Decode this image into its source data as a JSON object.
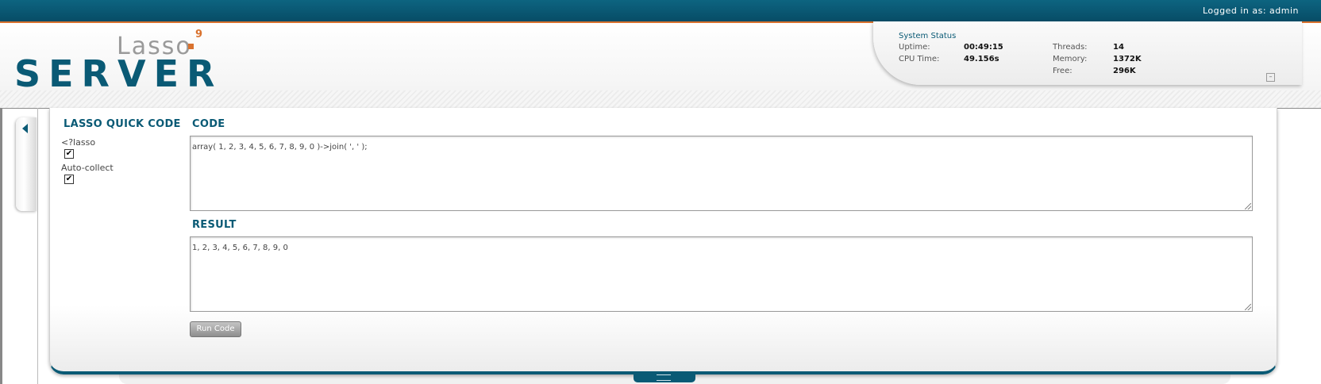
{
  "topbar": {
    "logged_in": "Logged in as: admin"
  },
  "logo": {
    "lasso": "Lasso",
    "version": "9",
    "server": "SERVER"
  },
  "system_status": {
    "title": "System Status",
    "uptime_label": "Uptime:",
    "uptime": "00:49:15",
    "cpu_label": "CPU Time:",
    "cpu": "49.156s",
    "threads_label": "Threads:",
    "threads": "14",
    "memory_label": "Memory:",
    "memory": "1372K",
    "free_label": "Free:",
    "free": "296K"
  },
  "quick_code": {
    "title": "LASSO QUICK CODE",
    "lasso_tag_label": "<?lasso",
    "lasso_tag_checked": true,
    "auto_collect_label": "Auto-collect",
    "auto_collect_checked": true
  },
  "code": {
    "title": "CODE",
    "value": "array( 1, 2, 3, 4, 5, 6, 7, 8, 9, 0 )->join( ', ' );"
  },
  "result": {
    "title": "RESULT",
    "value": "1, 2, 3, 4, 5, 6, 7, 8, 9, 0"
  },
  "run_button": {
    "label": "Run Code"
  },
  "colors": {
    "brand_teal": "#0a5a75",
    "accent_orange": "#d9722e"
  }
}
